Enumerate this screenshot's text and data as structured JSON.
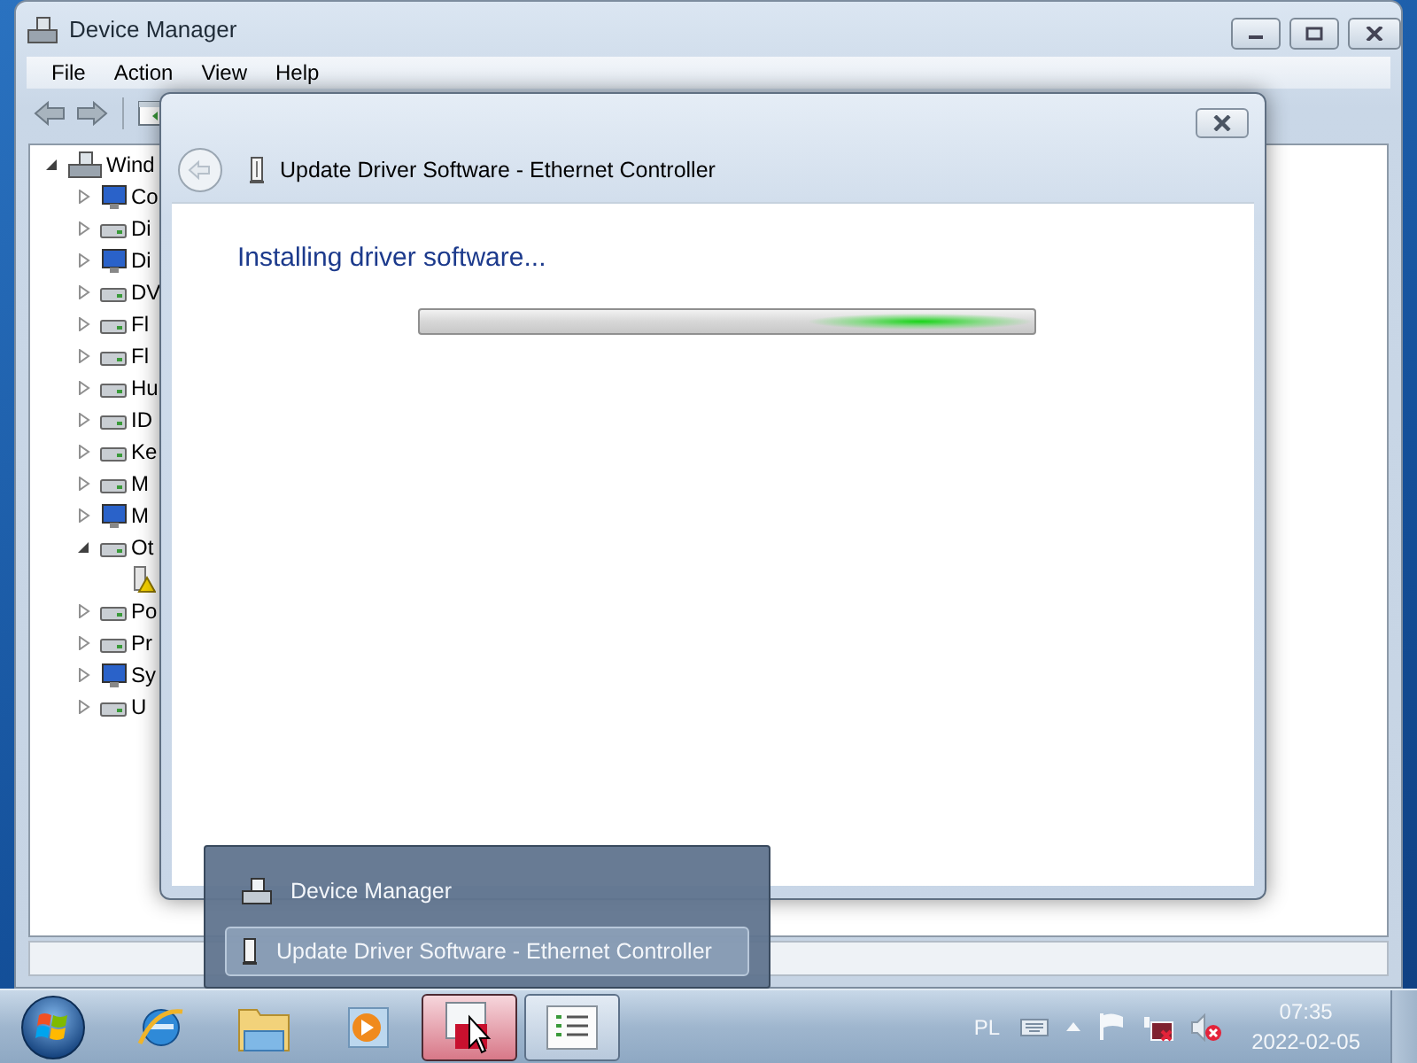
{
  "device_manager": {
    "title": "Device Manager",
    "menu": [
      "File",
      "Action",
      "View",
      "Help"
    ],
    "tree": {
      "label": "Wind",
      "expanded": true,
      "children": [
        {
          "label": "Co",
          "expanded": false
        },
        {
          "label": "Di",
          "expanded": false
        },
        {
          "label": "Di",
          "expanded": false
        },
        {
          "label": "DV",
          "expanded": false
        },
        {
          "label": "Fl",
          "expanded": false
        },
        {
          "label": "Fl",
          "expanded": false
        },
        {
          "label": "Hu",
          "expanded": false
        },
        {
          "label": "ID",
          "expanded": false
        },
        {
          "label": "Ke",
          "expanded": false
        },
        {
          "label": "M",
          "expanded": false
        },
        {
          "label": "M",
          "expanded": false
        },
        {
          "label": "Ot",
          "expanded": true,
          "children": [
            {
              "warning": true
            }
          ]
        },
        {
          "label": "Po",
          "expanded": false
        },
        {
          "label": "Pr",
          "expanded": false
        },
        {
          "label": "Sy",
          "expanded": false
        },
        {
          "label": "U",
          "expanded": false
        }
      ]
    }
  },
  "dialog": {
    "title": "Update Driver Software - Ethernet Controller",
    "heading": "Installing driver software...",
    "progress": {
      "kind": "marquee"
    }
  },
  "thumbnail_popup": {
    "items": [
      {
        "label": "Device Manager",
        "selected": false
      },
      {
        "label": "Update Driver Software - Ethernet Controller",
        "selected": true
      }
    ]
  },
  "taskbar": {
    "apps": [
      {
        "running": false,
        "active": false
      },
      {
        "running": false,
        "active": false
      },
      {
        "running": false,
        "active": false
      },
      {
        "running": true,
        "active": true
      },
      {
        "running": true,
        "active": false
      }
    ]
  },
  "tray": {
    "language": "PL",
    "volume_muted": true,
    "time": "07:35",
    "date": "2022-02-05"
  }
}
